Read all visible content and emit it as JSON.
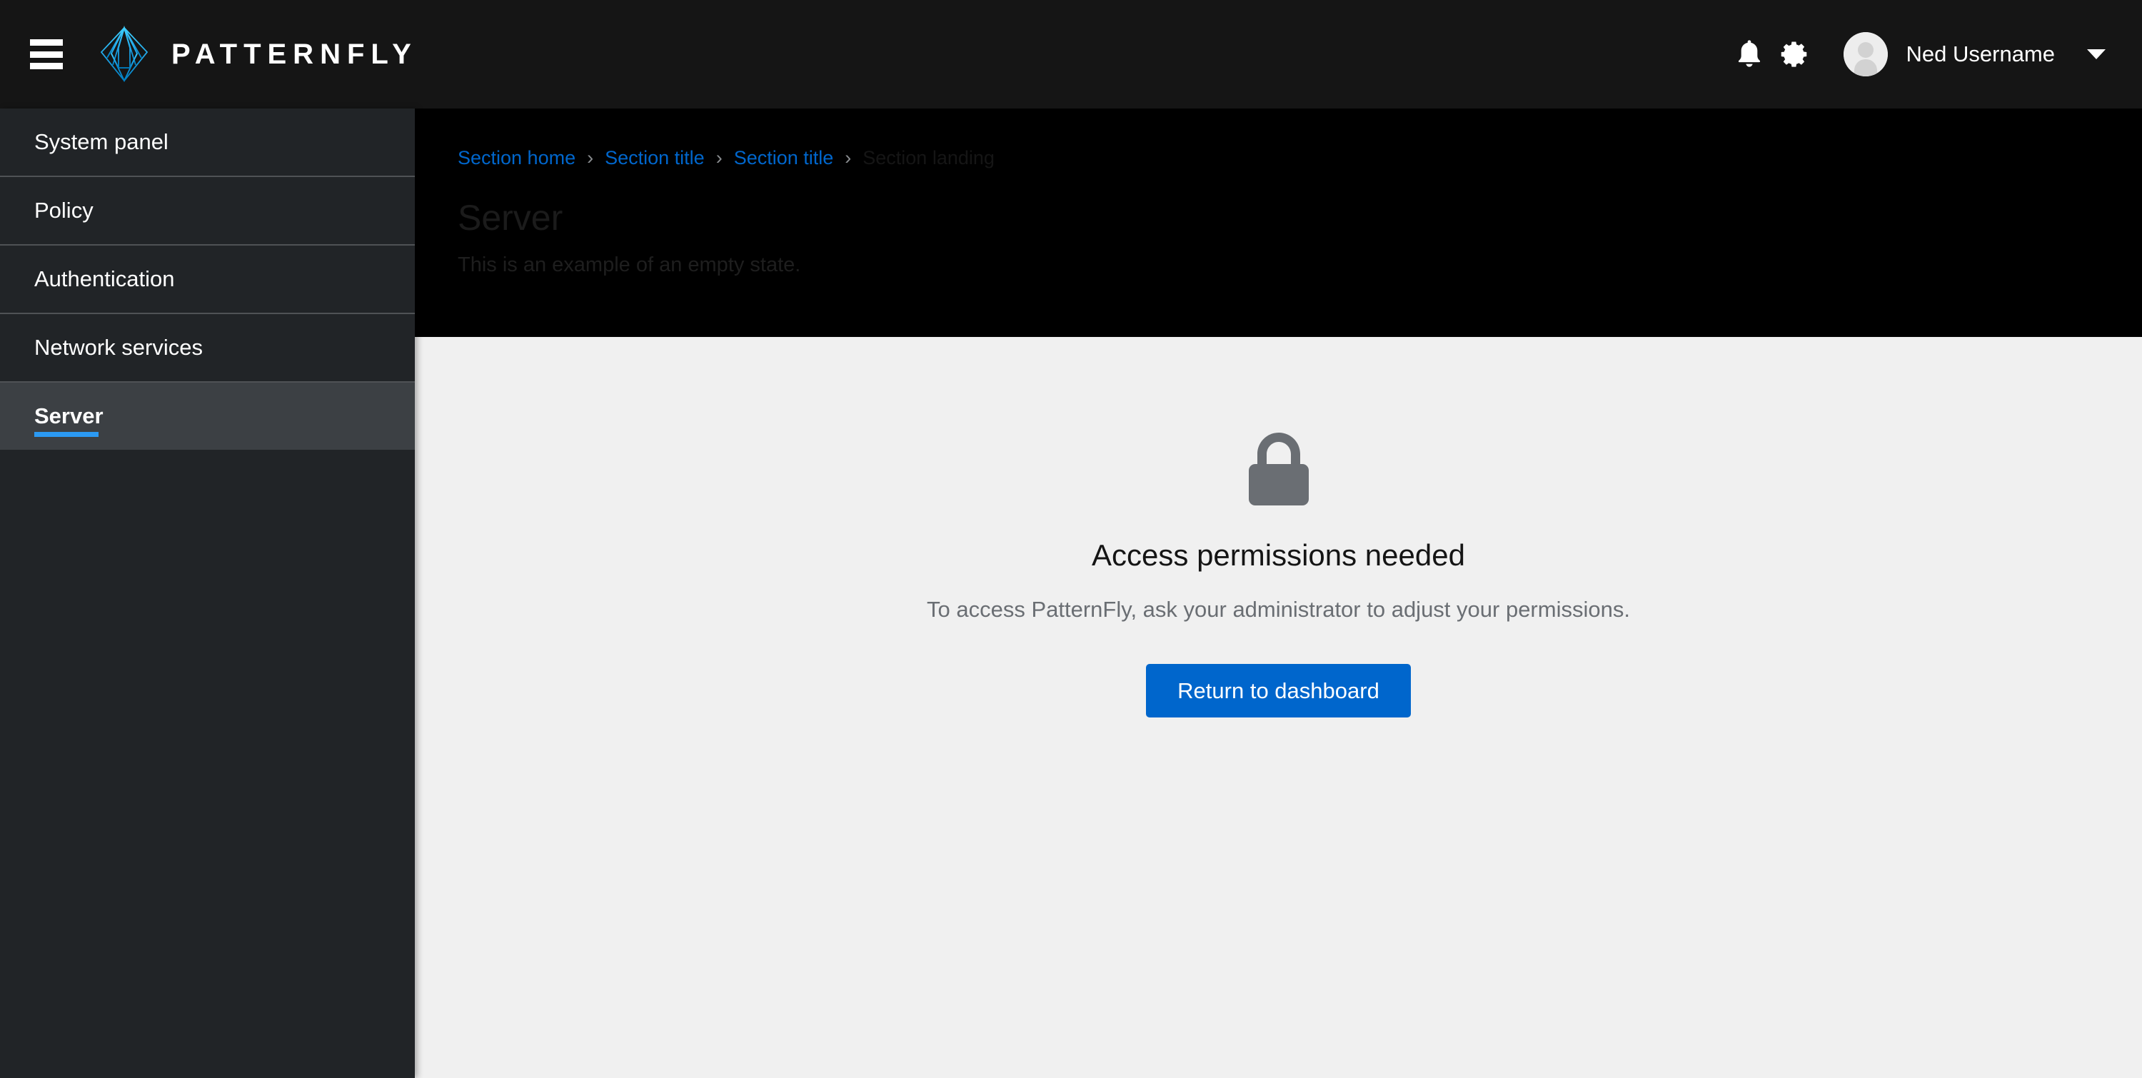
{
  "masthead": {
    "hamburger_label": "Global navigation toggle",
    "brand_name": "PATTERNFLY",
    "logo_icon": "patternfly-logo-icon",
    "notifications_icon": "bell-icon",
    "settings_icon": "gear-icon",
    "avatar_icon": "user-avatar-icon",
    "user_name": "Ned Username",
    "caret_icon": "caret-down-icon"
  },
  "sidebar": {
    "items": [
      {
        "label": "System panel",
        "active": false
      },
      {
        "label": "Policy",
        "active": false
      },
      {
        "label": "Authentication",
        "active": false
      },
      {
        "label": "Network services",
        "active": false
      },
      {
        "label": "Server",
        "active": true
      }
    ]
  },
  "breadcrumb": {
    "separator": "›",
    "items": [
      {
        "label": "Section home",
        "current": false
      },
      {
        "label": "Section title",
        "current": false
      },
      {
        "label": "Section title",
        "current": false
      },
      {
        "label": "Section landing",
        "current": true
      }
    ]
  },
  "page": {
    "title": "Server",
    "description": "This is an example of an empty state."
  },
  "empty_state": {
    "icon": "lock-icon",
    "title": "Access permissions needed",
    "body": "To access PatternFly, ask your administrator to adjust your permissions.",
    "primary_action": "Return to dashboard"
  },
  "colors": {
    "masthead_bg": "#151515",
    "sidebar_bg": "#212427",
    "sidebar_active_bg": "#3c4044",
    "accent_blue": "#0066cc",
    "active_bar_blue": "#2b9af3",
    "content_bg": "#f0f0f0",
    "page_header_bg": "#000000",
    "icon_gray": "#6a6e73"
  }
}
